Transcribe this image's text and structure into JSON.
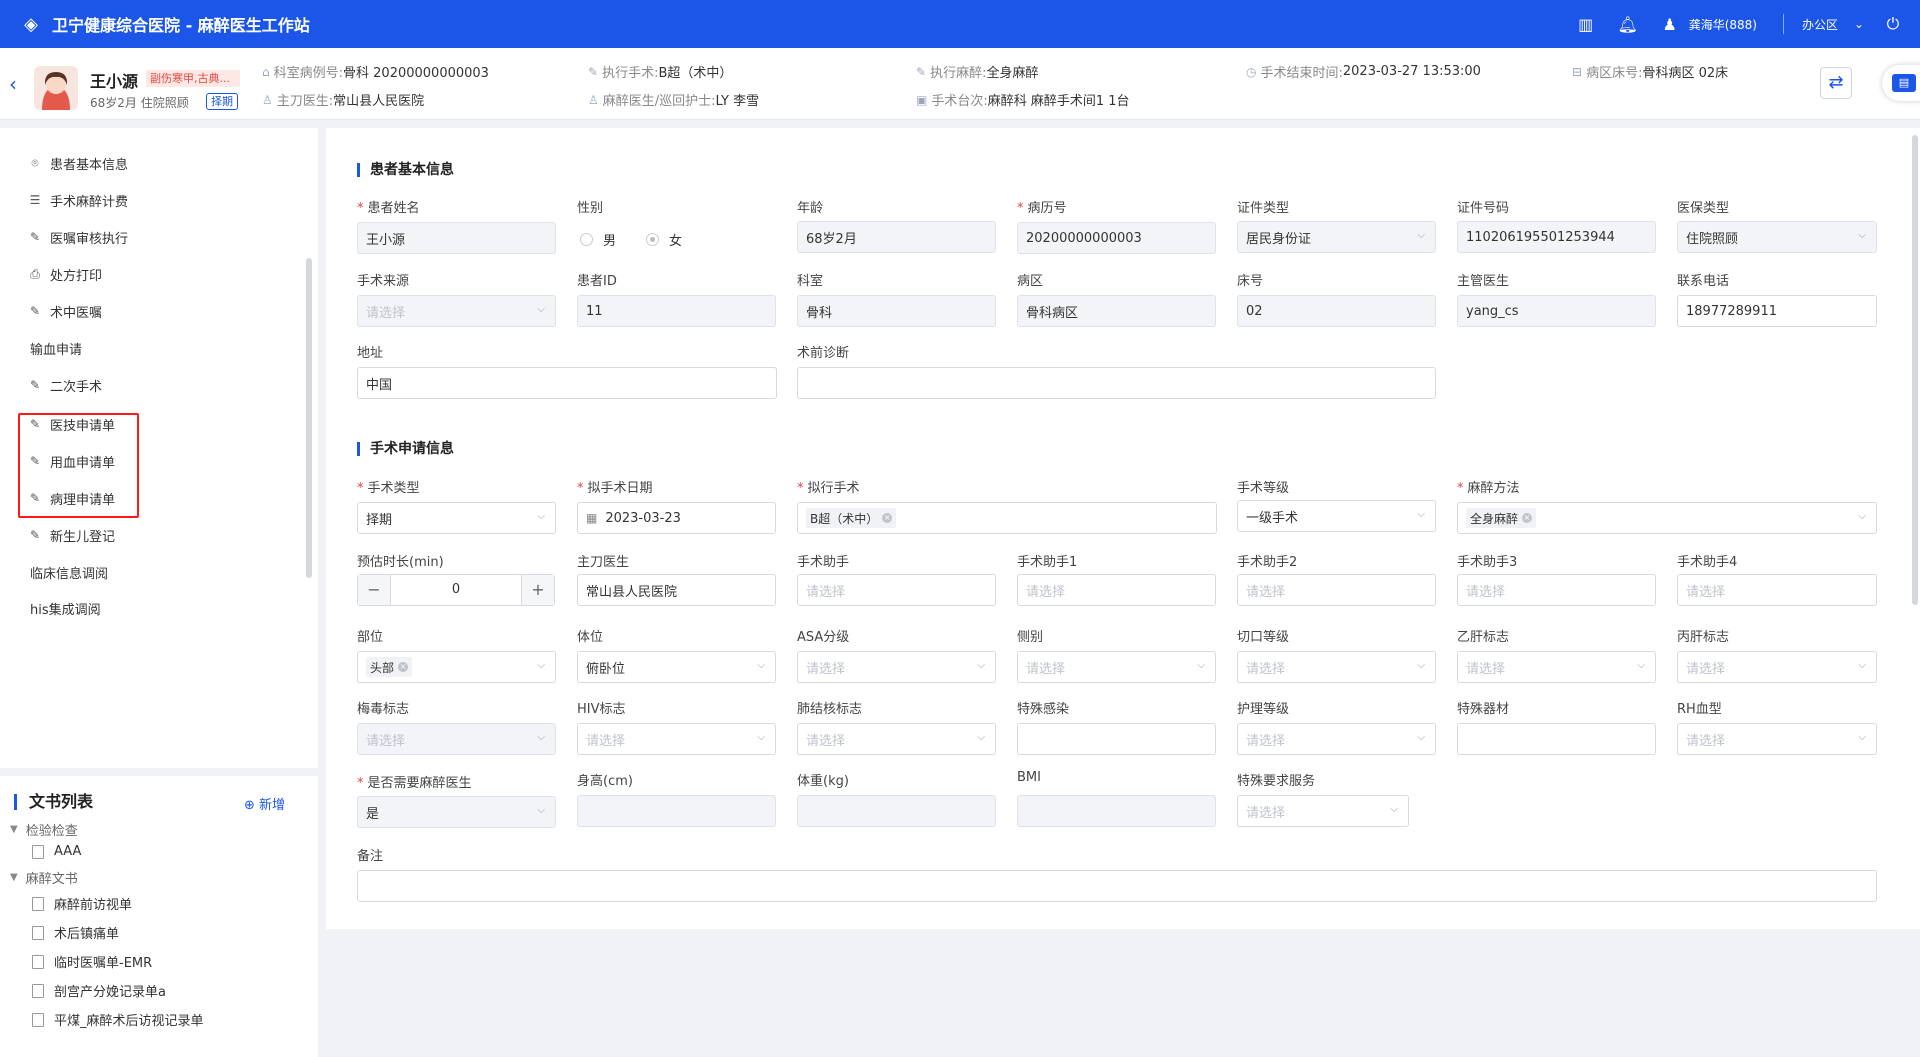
{
  "app": {
    "title": "卫宁健康综合医院 - 麻醉医生工作站",
    "user": "龚海华(888)",
    "area": "办公区"
  },
  "patient": {
    "name": "王小源",
    "tag": "副伤寒甲,古典...",
    "info": "68岁2月 住院照顾",
    "type": "择期",
    "dept_case_label": "科室病例号:",
    "dept_case": "骨科 20200000000003",
    "surgeon_label": "主刀医生:",
    "surgeon": "常山县人民医院",
    "op_label": "执行手术:",
    "op": "B超（术中）",
    "nurse_label": "麻醉医生/巡回护士:",
    "nurse": "LY 李雪",
    "anes_label": "执行麻醉:",
    "anes": "全身麻醉",
    "room_label": "手术台次:",
    "room": "麻醉科 麻醉手术间1 1台",
    "end_label": "手术结束时间:",
    "end": "2023-03-27 13:53:00",
    "bed_label": "病区床号:",
    "bed": "骨科病区 02床"
  },
  "sidebar": {
    "items": [
      {
        "icon": "⌾",
        "label": "患者基本信息"
      },
      {
        "icon": "☰",
        "label": "手术麻醉计费"
      },
      {
        "icon": "✎",
        "label": "医嘱审核执行"
      },
      {
        "icon": "⎙",
        "label": "处方打印"
      },
      {
        "icon": "✎",
        "label": "术中医嘱"
      },
      {
        "icon": "",
        "label": "输血申请"
      },
      {
        "icon": "✎",
        "label": "二次手术"
      },
      {
        "icon": "✎",
        "label": "医技申请单"
      },
      {
        "icon": "✎",
        "label": "用血申请单"
      },
      {
        "icon": "✎",
        "label": "病理申请单"
      },
      {
        "icon": "✎",
        "label": "新生儿登记"
      },
      {
        "icon": "",
        "label": "临床信息调阅"
      },
      {
        "icon": "",
        "label": "his集成调阅"
      }
    ]
  },
  "docs": {
    "title": "文书列表",
    "add": "⊕ 新增",
    "groups": [
      {
        "label": "检验检查",
        "items": [
          "AAA"
        ]
      },
      {
        "label": "麻醉文书",
        "items": [
          "麻醉前访视单",
          "术后镇痛单",
          "临时医嘱单-EMR",
          "剖宫产分娩记录单a",
          "平煤_麻醉术后访视记录单"
        ]
      }
    ]
  },
  "basic": {
    "title": "患者基本信息",
    "name_label": "患者姓名",
    "name": "王小源",
    "sex_label": "性别",
    "male": "男",
    "female": "女",
    "age_label": "年龄",
    "age": "68岁2月",
    "mrn_label": "病历号",
    "mrn": "20200000000003",
    "idtype_label": "证件类型",
    "idtype": "居民身份证",
    "idno_label": "证件号码",
    "idno": "110206195501253944",
    "ins_label": "医保类型",
    "ins": "住院照顾",
    "src_label": "手术来源",
    "src_ph": "请选择",
    "pid_label": "患者ID",
    "pid": "11",
    "dept_label": "科室",
    "dept": "骨科",
    "ward_label": "病区",
    "ward": "骨科病区",
    "bed_label": "床号",
    "bed": "02",
    "doc_label": "主管医生",
    "doc": "yang_cs",
    "phone_label": "联系电话",
    "phone": "18977289911",
    "addr_label": "地址",
    "addr": "中国",
    "diag_label": "术前诊断",
    "diag": ""
  },
  "surgery": {
    "title": "手术申请信息",
    "type_label": "手术类型",
    "type": "择期",
    "date_label": "拟手术日期",
    "date": "2023-03-23",
    "op_label": "拟行手术",
    "op": "B超（术中）",
    "grade_label": "手术等级",
    "grade": "一级手术",
    "anes_label": "麻醉方法",
    "anes": "全身麻醉",
    "dur_label": "预估时长(min)",
    "dur": "0",
    "minus": "−",
    "plus": "+",
    "surgeon_label": "主刀医生",
    "surgeon": "常山县人民医院",
    "a0_label": "手术助手",
    "a1_label": "手术助手1",
    "a2_label": "手术助手2",
    "a3_label": "手术助手3",
    "a4_label": "手术助手4",
    "site_label": "部位",
    "site": "头部",
    "pos_label": "体位",
    "pos": "俯卧位",
    "asa_label": "ASA分级",
    "side_label": "侧别",
    "cut_label": "切口等级",
    "hbv_label": "乙肝标志",
    "hcv_label": "丙肝标志",
    "syph_label": "梅毒标志",
    "hiv_label": "HIV标志",
    "tb_label": "肺结核标志",
    "inf_label": "特殊感染",
    "care_label": "护理等级",
    "equip_label": "特殊器材",
    "rh_label": "RH血型",
    "need_label": "是否需要麻醉医生",
    "need": "是",
    "height_label": "身高(cm)",
    "weight_label": "体重(kg)",
    "bmi_label": "BMI",
    "svc_label": "特殊要求服务",
    "remark_label": "备注",
    "ph": "请选择"
  }
}
